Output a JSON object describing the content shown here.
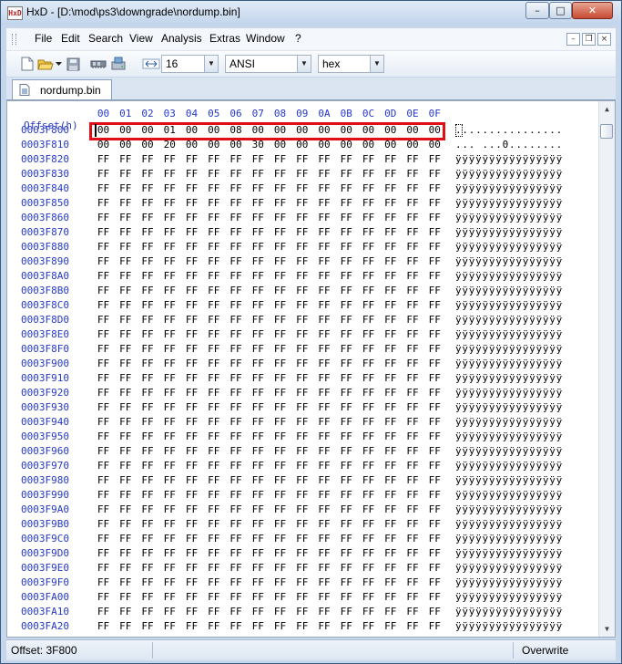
{
  "window": {
    "title": "HxD - [D:\\mod\\ps3\\downgrade\\nordump.bin]",
    "app_icon_label": "HxD",
    "minimize": "–",
    "maximize": "□",
    "close": "✕"
  },
  "menu": {
    "items": [
      "File",
      "Edit",
      "Search",
      "View",
      "Analysis",
      "Extras",
      "Window",
      "?"
    ],
    "mdi_minimize": "–",
    "mdi_restore": "❒",
    "mdi_close": "×"
  },
  "toolbar": {
    "bytes_per_row": "16",
    "charset": "ANSI",
    "offset_base": "hex",
    "dropdown_arrow": "▼"
  },
  "tab": {
    "label": "nordump.bin"
  },
  "editor": {
    "offset_header": "Offset(h)",
    "column_headers": [
      "00",
      "01",
      "02",
      "03",
      "04",
      "05",
      "06",
      "07",
      "08",
      "09",
      "0A",
      "0B",
      "0C",
      "0D",
      "0E",
      "0F"
    ],
    "rows": [
      {
        "offset": "0003F800",
        "bytes": [
          "00",
          "00",
          "00",
          "01",
          "00",
          "00",
          "08",
          "00",
          "00",
          "00",
          "00",
          "00",
          "00",
          "00",
          "00",
          "00"
        ],
        "ascii": "................"
      },
      {
        "offset": "0003F810",
        "bytes": [
          "00",
          "00",
          "00",
          "20",
          "00",
          "00",
          "00",
          "30",
          "00",
          "00",
          "00",
          "00",
          "00",
          "00",
          "00",
          "00"
        ],
        "ascii": "... ...0........"
      },
      {
        "offset": "0003F820",
        "bytes": [
          "FF",
          "FF",
          "FF",
          "FF",
          "FF",
          "FF",
          "FF",
          "FF",
          "FF",
          "FF",
          "FF",
          "FF",
          "FF",
          "FF",
          "FF",
          "FF"
        ],
        "ascii": "ÿÿÿÿÿÿÿÿÿÿÿÿÿÿÿÿ"
      },
      {
        "offset": "0003F830",
        "bytes": [
          "FF",
          "FF",
          "FF",
          "FF",
          "FF",
          "FF",
          "FF",
          "FF",
          "FF",
          "FF",
          "FF",
          "FF",
          "FF",
          "FF",
          "FF",
          "FF"
        ],
        "ascii": "ÿÿÿÿÿÿÿÿÿÿÿÿÿÿÿÿ"
      },
      {
        "offset": "0003F840",
        "bytes": [
          "FF",
          "FF",
          "FF",
          "FF",
          "FF",
          "FF",
          "FF",
          "FF",
          "FF",
          "FF",
          "FF",
          "FF",
          "FF",
          "FF",
          "FF",
          "FF"
        ],
        "ascii": "ÿÿÿÿÿÿÿÿÿÿÿÿÿÿÿÿ"
      },
      {
        "offset": "0003F850",
        "bytes": [
          "FF",
          "FF",
          "FF",
          "FF",
          "FF",
          "FF",
          "FF",
          "FF",
          "FF",
          "FF",
          "FF",
          "FF",
          "FF",
          "FF",
          "FF",
          "FF"
        ],
        "ascii": "ÿÿÿÿÿÿÿÿÿÿÿÿÿÿÿÿ"
      },
      {
        "offset": "0003F860",
        "bytes": [
          "FF",
          "FF",
          "FF",
          "FF",
          "FF",
          "FF",
          "FF",
          "FF",
          "FF",
          "FF",
          "FF",
          "FF",
          "FF",
          "FF",
          "FF",
          "FF"
        ],
        "ascii": "ÿÿÿÿÿÿÿÿÿÿÿÿÿÿÿÿ"
      },
      {
        "offset": "0003F870",
        "bytes": [
          "FF",
          "FF",
          "FF",
          "FF",
          "FF",
          "FF",
          "FF",
          "FF",
          "FF",
          "FF",
          "FF",
          "FF",
          "FF",
          "FF",
          "FF",
          "FF"
        ],
        "ascii": "ÿÿÿÿÿÿÿÿÿÿÿÿÿÿÿÿ"
      },
      {
        "offset": "0003F880",
        "bytes": [
          "FF",
          "FF",
          "FF",
          "FF",
          "FF",
          "FF",
          "FF",
          "FF",
          "FF",
          "FF",
          "FF",
          "FF",
          "FF",
          "FF",
          "FF",
          "FF"
        ],
        "ascii": "ÿÿÿÿÿÿÿÿÿÿÿÿÿÿÿÿ"
      },
      {
        "offset": "0003F890",
        "bytes": [
          "FF",
          "FF",
          "FF",
          "FF",
          "FF",
          "FF",
          "FF",
          "FF",
          "FF",
          "FF",
          "FF",
          "FF",
          "FF",
          "FF",
          "FF",
          "FF"
        ],
        "ascii": "ÿÿÿÿÿÿÿÿÿÿÿÿÿÿÿÿ"
      },
      {
        "offset": "0003F8A0",
        "bytes": [
          "FF",
          "FF",
          "FF",
          "FF",
          "FF",
          "FF",
          "FF",
          "FF",
          "FF",
          "FF",
          "FF",
          "FF",
          "FF",
          "FF",
          "FF",
          "FF"
        ],
        "ascii": "ÿÿÿÿÿÿÿÿÿÿÿÿÿÿÿÿ"
      },
      {
        "offset": "0003F8B0",
        "bytes": [
          "FF",
          "FF",
          "FF",
          "FF",
          "FF",
          "FF",
          "FF",
          "FF",
          "FF",
          "FF",
          "FF",
          "FF",
          "FF",
          "FF",
          "FF",
          "FF"
        ],
        "ascii": "ÿÿÿÿÿÿÿÿÿÿÿÿÿÿÿÿ"
      },
      {
        "offset": "0003F8C0",
        "bytes": [
          "FF",
          "FF",
          "FF",
          "FF",
          "FF",
          "FF",
          "FF",
          "FF",
          "FF",
          "FF",
          "FF",
          "FF",
          "FF",
          "FF",
          "FF",
          "FF"
        ],
        "ascii": "ÿÿÿÿÿÿÿÿÿÿÿÿÿÿÿÿ"
      },
      {
        "offset": "0003F8D0",
        "bytes": [
          "FF",
          "FF",
          "FF",
          "FF",
          "FF",
          "FF",
          "FF",
          "FF",
          "FF",
          "FF",
          "FF",
          "FF",
          "FF",
          "FF",
          "FF",
          "FF"
        ],
        "ascii": "ÿÿÿÿÿÿÿÿÿÿÿÿÿÿÿÿ"
      },
      {
        "offset": "0003F8E0",
        "bytes": [
          "FF",
          "FF",
          "FF",
          "FF",
          "FF",
          "FF",
          "FF",
          "FF",
          "FF",
          "FF",
          "FF",
          "FF",
          "FF",
          "FF",
          "FF",
          "FF"
        ],
        "ascii": "ÿÿÿÿÿÿÿÿÿÿÿÿÿÿÿÿ"
      },
      {
        "offset": "0003F8F0",
        "bytes": [
          "FF",
          "FF",
          "FF",
          "FF",
          "FF",
          "FF",
          "FF",
          "FF",
          "FF",
          "FF",
          "FF",
          "FF",
          "FF",
          "FF",
          "FF",
          "FF"
        ],
        "ascii": "ÿÿÿÿÿÿÿÿÿÿÿÿÿÿÿÿ"
      },
      {
        "offset": "0003F900",
        "bytes": [
          "FF",
          "FF",
          "FF",
          "FF",
          "FF",
          "FF",
          "FF",
          "FF",
          "FF",
          "FF",
          "FF",
          "FF",
          "FF",
          "FF",
          "FF",
          "FF"
        ],
        "ascii": "ÿÿÿÿÿÿÿÿÿÿÿÿÿÿÿÿ"
      },
      {
        "offset": "0003F910",
        "bytes": [
          "FF",
          "FF",
          "FF",
          "FF",
          "FF",
          "FF",
          "FF",
          "FF",
          "FF",
          "FF",
          "FF",
          "FF",
          "FF",
          "FF",
          "FF",
          "FF"
        ],
        "ascii": "ÿÿÿÿÿÿÿÿÿÿÿÿÿÿÿÿ"
      },
      {
        "offset": "0003F920",
        "bytes": [
          "FF",
          "FF",
          "FF",
          "FF",
          "FF",
          "FF",
          "FF",
          "FF",
          "FF",
          "FF",
          "FF",
          "FF",
          "FF",
          "FF",
          "FF",
          "FF"
        ],
        "ascii": "ÿÿÿÿÿÿÿÿÿÿÿÿÿÿÿÿ"
      },
      {
        "offset": "0003F930",
        "bytes": [
          "FF",
          "FF",
          "FF",
          "FF",
          "FF",
          "FF",
          "FF",
          "FF",
          "FF",
          "FF",
          "FF",
          "FF",
          "FF",
          "FF",
          "FF",
          "FF"
        ],
        "ascii": "ÿÿÿÿÿÿÿÿÿÿÿÿÿÿÿÿ"
      },
      {
        "offset": "0003F940",
        "bytes": [
          "FF",
          "FF",
          "FF",
          "FF",
          "FF",
          "FF",
          "FF",
          "FF",
          "FF",
          "FF",
          "FF",
          "FF",
          "FF",
          "FF",
          "FF",
          "FF"
        ],
        "ascii": "ÿÿÿÿÿÿÿÿÿÿÿÿÿÿÿÿ"
      },
      {
        "offset": "0003F950",
        "bytes": [
          "FF",
          "FF",
          "FF",
          "FF",
          "FF",
          "FF",
          "FF",
          "FF",
          "FF",
          "FF",
          "FF",
          "FF",
          "FF",
          "FF",
          "FF",
          "FF"
        ],
        "ascii": "ÿÿÿÿÿÿÿÿÿÿÿÿÿÿÿÿ"
      },
      {
        "offset": "0003F960",
        "bytes": [
          "FF",
          "FF",
          "FF",
          "FF",
          "FF",
          "FF",
          "FF",
          "FF",
          "FF",
          "FF",
          "FF",
          "FF",
          "FF",
          "FF",
          "FF",
          "FF"
        ],
        "ascii": "ÿÿÿÿÿÿÿÿÿÿÿÿÿÿÿÿ"
      },
      {
        "offset": "0003F970",
        "bytes": [
          "FF",
          "FF",
          "FF",
          "FF",
          "FF",
          "FF",
          "FF",
          "FF",
          "FF",
          "FF",
          "FF",
          "FF",
          "FF",
          "FF",
          "FF",
          "FF"
        ],
        "ascii": "ÿÿÿÿÿÿÿÿÿÿÿÿÿÿÿÿ"
      },
      {
        "offset": "0003F980",
        "bytes": [
          "FF",
          "FF",
          "FF",
          "FF",
          "FF",
          "FF",
          "FF",
          "FF",
          "FF",
          "FF",
          "FF",
          "FF",
          "FF",
          "FF",
          "FF",
          "FF"
        ],
        "ascii": "ÿÿÿÿÿÿÿÿÿÿÿÿÿÿÿÿ"
      },
      {
        "offset": "0003F990",
        "bytes": [
          "FF",
          "FF",
          "FF",
          "FF",
          "FF",
          "FF",
          "FF",
          "FF",
          "FF",
          "FF",
          "FF",
          "FF",
          "FF",
          "FF",
          "FF",
          "FF"
        ],
        "ascii": "ÿÿÿÿÿÿÿÿÿÿÿÿÿÿÿÿ"
      },
      {
        "offset": "0003F9A0",
        "bytes": [
          "FF",
          "FF",
          "FF",
          "FF",
          "FF",
          "FF",
          "FF",
          "FF",
          "FF",
          "FF",
          "FF",
          "FF",
          "FF",
          "FF",
          "FF",
          "FF"
        ],
        "ascii": "ÿÿÿÿÿÿÿÿÿÿÿÿÿÿÿÿ"
      },
      {
        "offset": "0003F9B0",
        "bytes": [
          "FF",
          "FF",
          "FF",
          "FF",
          "FF",
          "FF",
          "FF",
          "FF",
          "FF",
          "FF",
          "FF",
          "FF",
          "FF",
          "FF",
          "FF",
          "FF"
        ],
        "ascii": "ÿÿÿÿÿÿÿÿÿÿÿÿÿÿÿÿ"
      },
      {
        "offset": "0003F9C0",
        "bytes": [
          "FF",
          "FF",
          "FF",
          "FF",
          "FF",
          "FF",
          "FF",
          "FF",
          "FF",
          "FF",
          "FF",
          "FF",
          "FF",
          "FF",
          "FF",
          "FF"
        ],
        "ascii": "ÿÿÿÿÿÿÿÿÿÿÿÿÿÿÿÿ"
      },
      {
        "offset": "0003F9D0",
        "bytes": [
          "FF",
          "FF",
          "FF",
          "FF",
          "FF",
          "FF",
          "FF",
          "FF",
          "FF",
          "FF",
          "FF",
          "FF",
          "FF",
          "FF",
          "FF",
          "FF"
        ],
        "ascii": "ÿÿÿÿÿÿÿÿÿÿÿÿÿÿÿÿ"
      },
      {
        "offset": "0003F9E0",
        "bytes": [
          "FF",
          "FF",
          "FF",
          "FF",
          "FF",
          "FF",
          "FF",
          "FF",
          "FF",
          "FF",
          "FF",
          "FF",
          "FF",
          "FF",
          "FF",
          "FF"
        ],
        "ascii": "ÿÿÿÿÿÿÿÿÿÿÿÿÿÿÿÿ"
      },
      {
        "offset": "0003F9F0",
        "bytes": [
          "FF",
          "FF",
          "FF",
          "FF",
          "FF",
          "FF",
          "FF",
          "FF",
          "FF",
          "FF",
          "FF",
          "FF",
          "FF",
          "FF",
          "FF",
          "FF"
        ],
        "ascii": "ÿÿÿÿÿÿÿÿÿÿÿÿÿÿÿÿ"
      },
      {
        "offset": "0003FA00",
        "bytes": [
          "FF",
          "FF",
          "FF",
          "FF",
          "FF",
          "FF",
          "FF",
          "FF",
          "FF",
          "FF",
          "FF",
          "FF",
          "FF",
          "FF",
          "FF",
          "FF"
        ],
        "ascii": "ÿÿÿÿÿÿÿÿÿÿÿÿÿÿÿÿ"
      },
      {
        "offset": "0003FA10",
        "bytes": [
          "FF",
          "FF",
          "FF",
          "FF",
          "FF",
          "FF",
          "FF",
          "FF",
          "FF",
          "FF",
          "FF",
          "FF",
          "FF",
          "FF",
          "FF",
          "FF"
        ],
        "ascii": "ÿÿÿÿÿÿÿÿÿÿÿÿÿÿÿÿ"
      },
      {
        "offset": "0003FA20",
        "bytes": [
          "FF",
          "FF",
          "FF",
          "FF",
          "FF",
          "FF",
          "FF",
          "FF",
          "FF",
          "FF",
          "FF",
          "FF",
          "FF",
          "FF",
          "FF",
          "FF"
        ],
        "ascii": "ÿÿÿÿÿÿÿÿÿÿÿÿÿÿÿÿ"
      }
    ],
    "scroll_up": "▲",
    "scroll_down": "▼"
  },
  "status": {
    "offset": "Offset: 3F800",
    "mode": "Overwrite"
  },
  "colors": {
    "offset_blue": "#2639c8",
    "highlight_red": "#e10f15"
  }
}
